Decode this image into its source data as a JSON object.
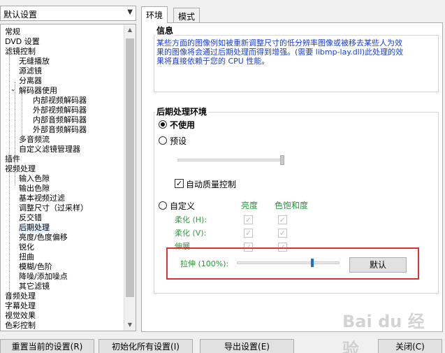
{
  "preset": {
    "value": "默认设置"
  },
  "tree": {
    "items": [
      {
        "label": "常规"
      },
      {
        "label": "DVD 设置"
      },
      {
        "label": "滤镜控制"
      },
      {
        "label": "无缝播放"
      },
      {
        "label": "源滤镜"
      },
      {
        "label": "分离器"
      },
      {
        "label": "解码器使用"
      },
      {
        "label": "内部视频解码器"
      },
      {
        "label": "外部视频解码器"
      },
      {
        "label": "内部音频解码器"
      },
      {
        "label": "外部音频解码器"
      },
      {
        "label": "多音频流"
      },
      {
        "label": "自定义滤镜管理器"
      },
      {
        "label": "插件"
      },
      {
        "label": "视频处理"
      },
      {
        "label": "输入色隙"
      },
      {
        "label": "输出色隙"
      },
      {
        "label": "基本视频过滤"
      },
      {
        "label": "调整尺寸（过采样）"
      },
      {
        "label": "反交错"
      },
      {
        "label": "后期处理"
      },
      {
        "label": "亮度/色度偏移"
      },
      {
        "label": "锐化"
      },
      {
        "label": "扭曲"
      },
      {
        "label": "模糊/色阶"
      },
      {
        "label": "降噪/添加噪点"
      },
      {
        "label": "其它滤镜"
      },
      {
        "label": "音频处理"
      },
      {
        "label": "字幕处理"
      },
      {
        "label": "视觉效果"
      },
      {
        "label": "色彩控制"
      }
    ]
  },
  "tabs": [
    {
      "label": "环境"
    },
    {
      "label": "模式"
    }
  ],
  "info": {
    "title": "信息",
    "text": "某些方面的图像例如被重新调整尺寸的低分辨率图像或被移去某些人为效果的图像将会通过后期处理而得到增强。(需要 libmp-lay.dll)此处理的效果将直接依赖于您的 CPU 性能。"
  },
  "postproc": {
    "title": "后期处理环境",
    "opt_none": "不使用",
    "opt_preset": "预设",
    "auto_quality": "自动质量控制",
    "opt_custom": "自定义",
    "col_brightness": "亮度",
    "col_saturation": "色饱和度",
    "row_soft_h": "柔化 (H):",
    "row_soft_v": "柔化 (V):",
    "row_deblock": "伸展",
    "stretch_label": "拉伸 (100%):",
    "stretch_percent": 30,
    "default_btn": "默认"
  },
  "bottom": {
    "reset": "重置当前的设置(R)",
    "init_all": "初始化所有设置(I)",
    "export": "导出设置(E)",
    "close": "关闭(C)"
  },
  "watermark": "Bai du 经验"
}
